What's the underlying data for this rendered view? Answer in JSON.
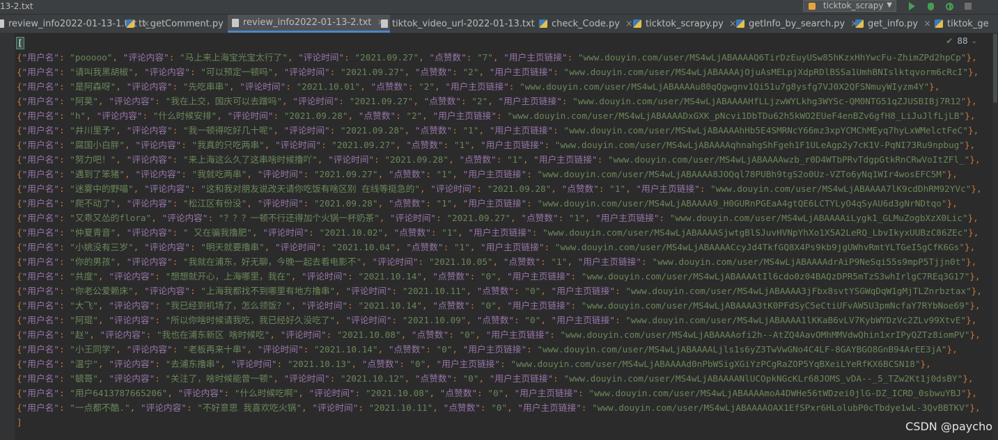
{
  "title_bar": {
    "title": "13-2.txt",
    "run_config": {
      "label": "ticktok_scrapy",
      "icon": "python-run-config-icon"
    },
    "actions": [
      {
        "name": "run-button",
        "icon": "play-icon"
      },
      {
        "name": "debug-button",
        "icon": "bug-icon"
      },
      {
        "name": "coverage-button",
        "icon": "coverage-icon"
      },
      {
        "name": "stop-button",
        "icon": "stop-icon"
      }
    ]
  },
  "tabs": [
    {
      "label": "review_info2022-01-13-1.txt",
      "icon": "txt",
      "active": false,
      "closable": true
    },
    {
      "label": "tt_getComment.py",
      "icon": "py",
      "active": false,
      "closable": true
    },
    {
      "label": "review_info2022-01-13-2.txt",
      "icon": "txt",
      "active": true,
      "closable": true
    },
    {
      "label": "tiktok_video_url-2022-01-13.txt",
      "icon": "txt",
      "active": false,
      "closable": true
    },
    {
      "label": "check_Code.py",
      "icon": "py",
      "active": false,
      "closable": true
    },
    {
      "label": "ticktok_scrapy.py",
      "icon": "py",
      "active": false,
      "closable": true
    },
    {
      "label": "getInfo_by_search.py",
      "icon": "py",
      "active": false,
      "closable": true
    },
    {
      "label": "get_info.py",
      "icon": "py",
      "active": false,
      "closable": true
    },
    {
      "label": "tiktok_ge",
      "icon": "py",
      "active": false,
      "closable": false
    }
  ],
  "editor": {
    "inspection_count": "88",
    "open_bracket": "[",
    "close_bracket": "]",
    "keys": [
      "用户名",
      "评论内容",
      "评论时间",
      "点赞数",
      "用户主页链接"
    ],
    "records": [
      [
        "pooooo",
        "马上来上海宝光宝太行了",
        "2021.09.27",
        "7",
        "www.douyin.com/user/MS4wLjABAAAAQ6TirDzEuyUSw85hKzxHhYwcFu-ZhimZPd2hpCp"
      ],
      [
        "请叫我黑胡椒",
        "可以预定一顿吗",
        "2021.09.27",
        "2",
        "www.douyin.com/user/MS4wLjABAAAAjOjuAsMELpjXdpRDlBSSa1UmhBNIslktqvorm6cRcI"
      ],
      [
        "是阿森呀",
        "先吃串串",
        "2021.10.01",
        "2",
        "www.douyin.com/user/MS4wLjABAAAAu80qQgwgnv1Qi51u7g8ysfg7VJ0X2QFSNmuyWIyzm4Y"
      ],
      [
        "阿昊",
        "我在上交，国庆可以去蹭吗",
        "2021.09.27",
        "2",
        "www.douyin.com/user/MS4wLjABAAAAHfLLjzwWYLkhg3WYSc-QM0NTG51qZJUSBIBj7R12"
      ],
      [
        "h",
        "什么时候安排",
        "2021.09.28",
        "2",
        "www.douyin.com/user/MS4wLjABAAAADxGXK_pNcvi1DbTDu62h5kWO2EUeF4enBZv6gfH8_LiJuJlfLjLB"
      ],
      [
        "井川里予",
        "我一顿得吃好几十呢",
        "2021.09.28",
        "1",
        "www.douyin.com/user/MS4wLjABAAAAhHb5E4SMRNcY66mz3xpYCMChMEyq7hyLxWMelctFeC"
      ],
      [
        "腐国小白胖",
        "我真的只吃两串",
        "2021.09.27",
        "1",
        "www.douyin.com/user/MS4wLjABAAAAqhnahgShFgeh1F1ULeAgp2y7cK1V-PqNI73Ru9npbug"
      ],
      [
        "努力吧！",
        "来上海这么久了这串啥时候撸吖",
        "2021.09.28",
        "1",
        "www.douyin.com/user/MS4wLjABAAAAwzb_r0D4WTbPRvTdgpGtkRnCRwVoItZFl_"
      ],
      [
        "遇到了笨猪",
        "我就吃两串",
        "2021.09.27",
        "1",
        "www.douyin.com/user/MS4wLjABAAAA8JOQql78PUBh9tgS2o0Uz-VZTo6yNq1WIr4wosEFC5M"
      ],
      [
        "迷雾中的野喵",
        "这和我对朋友说改天请你吃饭有啥区别 在线等挺急的",
        "2021.09.28",
        "1",
        "www.douyin.com/user/MS4wLjABAAAA7lK9cdDhRM92YVc"
      ],
      [
        "爬不动了",
        "松江区有份没",
        "2021.09.28",
        "1",
        "www.douyin.com/user/MS4wLjABAAAA9_H0GURnPGEaA4gtQE6LCTYLyO4qSyAU6d3gNrNDtqo"
      ],
      [
        "又乖又怂的flora",
        "？？？一顿不行还得加个火锅一杯奶茶",
        "2021.09.27",
        "1",
        "www.douyin.com/user/MS4wLjABAAAAiLygk1_GLMuZogbXzX0Lic"
      ],
      [
        "仲夏青音",
        " 又在骗我撸肥",
        "2021.10.02",
        "1",
        "www.douyin.com/user/MS4wLjABAAAASjwtgBlSJuvHVNpYhXo1X5A2LeRQ_LbvIkyxUUBzC86ZEc"
      ],
      [
        "小姚没有三岁",
        "明天就要撸串",
        "2021.10.04",
        "1",
        "www.douyin.com/user/MS4wLjABAAAACcyJd4TkfGQ8X4Ps9kb9jgUWhvRmtYLTGeI5gCfK6Gs"
      ],
      [
        "你的男孩",
        "我就在浦东，好无聊，今晚一起去看电影不",
        "2021.10.05",
        "1",
        "www.douyin.com/user/MS4wLjABAAAAdrAiP9NeSqi55s9mpP5Tjjn0t"
      ],
      [
        "共度",
        "想想就开心，上海哪里，我在",
        "2021.10.14",
        "0",
        "www.douyin.com/user/MS4wLjABAAAAtIl6cdo0z04BAQzDPR5mTzS3whIrlgC7REq3G17"
      ],
      [
        "你老公爱赖床",
        "上海我都找不到哪里有地方撸串",
        "2021.10.11",
        "0",
        "www.douyin.com/user/MS4wLjABAAAA3jFbx8svtYSGWqDqW1gMjTLZnrbztax"
      ],
      [
        "大飞",
        "我已经到机场了，怎么领饭？",
        "2021.10.14",
        "0",
        "www.douyin.com/user/MS4wLjABAAAA3tK0PFdSyC5eCtiUFvAW5U3pmNcfaY7RYbNoe69"
      ],
      [
        "阿琨",
        "所以你啥时候请我吃，我已经好久没吃了",
        "2021.10.09",
        "0",
        "www.douyin.com/user/MS4wLjABAAAA1lKKaB6vLV7KybWYDzVc2ZLv99XtvE"
      ],
      [
        "赵",
        "我也在浦东新区 啥时候吃",
        "2021.10.08",
        "0",
        "www.douyin.com/user/MS4wLjABAAAAofi2h--AtZQ4AavOMhMMVdwQhin1xrIPyQZTz8iomPV"
      ],
      [
        "小王同学",
        "老板再来十串",
        "2021.10.14",
        "0",
        "www.douyin.com/user/MS4wLjABAAAALjls1s6yZ3TwVwGNo4C4LF-8GAYBGO8GnB94ArEE3jA"
      ],
      [
        "温宁",
        "去浦东撸串",
        "2021.10.13",
        "0",
        "www.douyin.com/user/MS4wLjABAAAAd0nPbWSigXGiYzPCgRaZOP5YqBXeiLYeRfKX6BCSN18"
      ],
      [
        "毓哥",
        "关注了，啥时候能曾一顿",
        "2021.10.12",
        "0",
        "www.douyin.com/user/MS4wLjABAAAANlUCOpkNGcKLr68JOMS_vDA--_5_TZw2Kt1j0dsBY"
      ],
      [
        "用户6413787665206",
        "什么时候吃啊",
        "2021.10.08",
        "0",
        "www.douyin.com/user/MS4wLjABAAAAmoA4DWHe56tWDzei0jlG-DZ_ICRD_0sbwuYBJ"
      ],
      [
        "一点都不酷.",
        "不好意思 我喜欢吃火锅",
        "2021.10.11",
        "0",
        "www.douyin.com/user/MS4wLjABAAAAOAX1EfSPxr6HLolubP0cTbdye1wL-3QvBBTKV"
      ]
    ]
  },
  "watermark": "CSDN @paycho"
}
